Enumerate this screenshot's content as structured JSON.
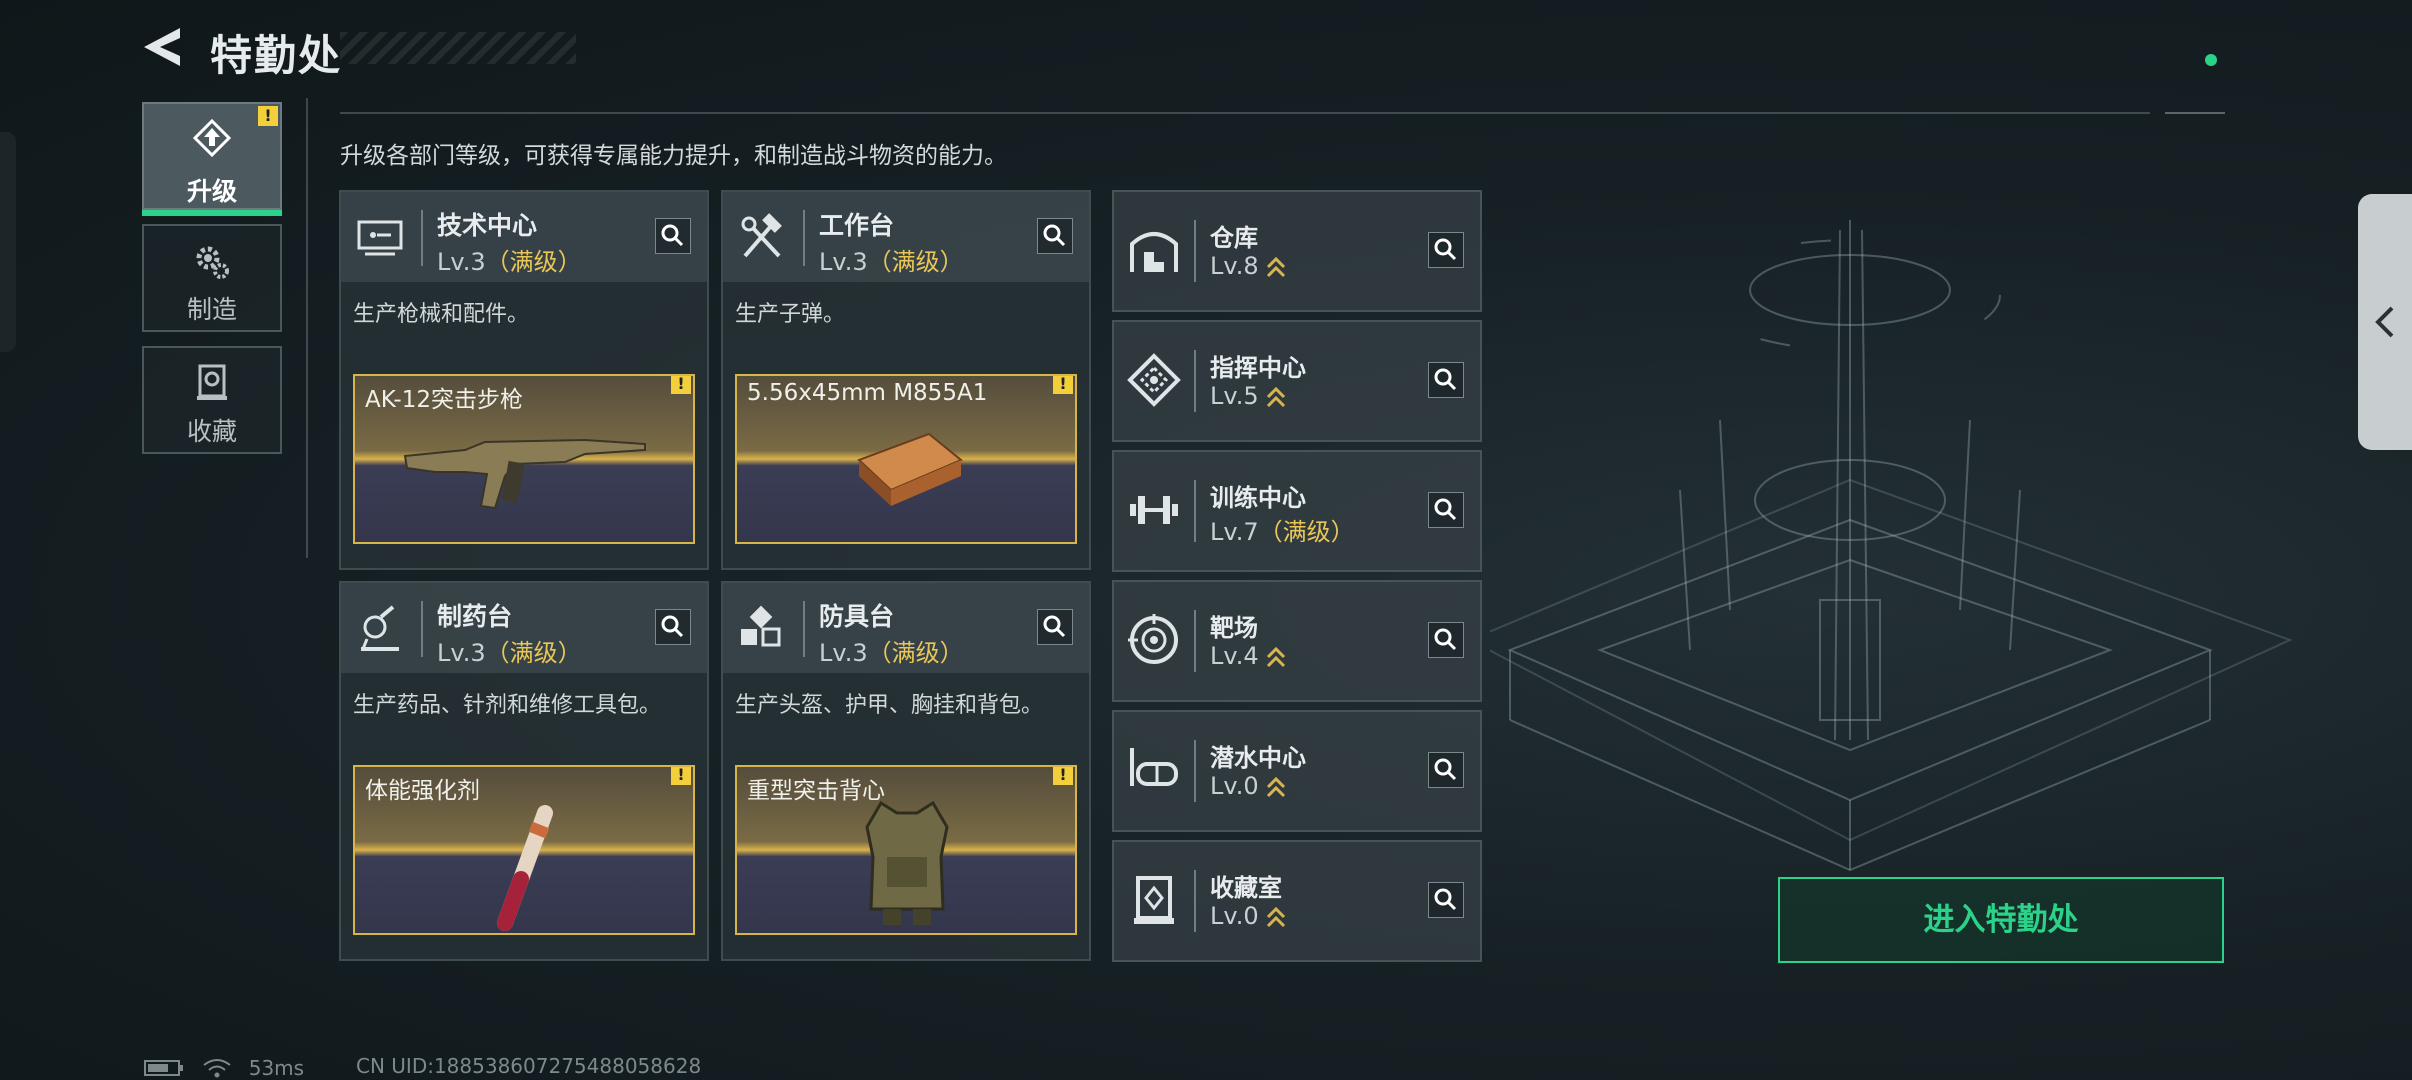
{
  "header": {
    "title": "特勤处",
    "back_icon": "back-arrow-icon"
  },
  "description": "升级各部门等级，可获得专属能力提升，和制造战斗物资的能力。",
  "side_tabs": [
    {
      "label": "升级",
      "icon": "upgrade-icon",
      "active": true,
      "alert": "!"
    },
    {
      "label": "制造",
      "icon": "gears-icon",
      "active": false
    },
    {
      "label": "收藏",
      "icon": "collection-icon",
      "active": false
    }
  ],
  "workshops": [
    {
      "name": "技术中心",
      "level": "Lv.3",
      "max": "（满级）",
      "desc": "生产枪械和配件。",
      "item": "AK-12突击步枪",
      "alert": "!",
      "icon": "tech-center-icon"
    },
    {
      "name": "工作台",
      "level": "Lv.3",
      "max": "（满级）",
      "desc": "生产子弹。",
      "item": "5.56x45mm M855A1",
      "alert": "!",
      "icon": "workbench-icon"
    },
    {
      "name": "制药台",
      "level": "Lv.3",
      "max": "（满级）",
      "desc": "生产药品、针剂和维修工具包。",
      "item": "体能强化剂",
      "alert": "!",
      "icon": "pharmacy-icon"
    },
    {
      "name": "防具台",
      "level": "Lv.3",
      "max": "（满级）",
      "desc": "生产头盔、护甲、胸挂和背包。",
      "item": "重型突击背心",
      "alert": "!",
      "icon": "armor-bench-icon"
    }
  ],
  "facilities": [
    {
      "name": "仓库",
      "level": "Lv.8",
      "max": "",
      "icon": "warehouse-icon"
    },
    {
      "name": "指挥中心",
      "level": "Lv.5",
      "max": "",
      "icon": "command-center-icon"
    },
    {
      "name": "训练中心",
      "level": "Lv.7",
      "max": "（满级）",
      "icon": "training-center-icon"
    },
    {
      "name": "靶场",
      "level": "Lv.4",
      "max": "",
      "icon": "shooting-range-icon"
    },
    {
      "name": "潜水中心",
      "level": "Lv.0",
      "max": "",
      "icon": "diving-center-icon"
    },
    {
      "name": "收藏室",
      "level": "Lv.0",
      "max": "",
      "icon": "collection-room-icon"
    }
  ],
  "enter_button": "进入特勤处",
  "status": {
    "ping": "53ms",
    "uid": "CN UID:18853860727548805862​8"
  },
  "colors": {
    "accent": "#2bd28a",
    "gold": "#e8c658",
    "warn": "#f3cf3b"
  }
}
